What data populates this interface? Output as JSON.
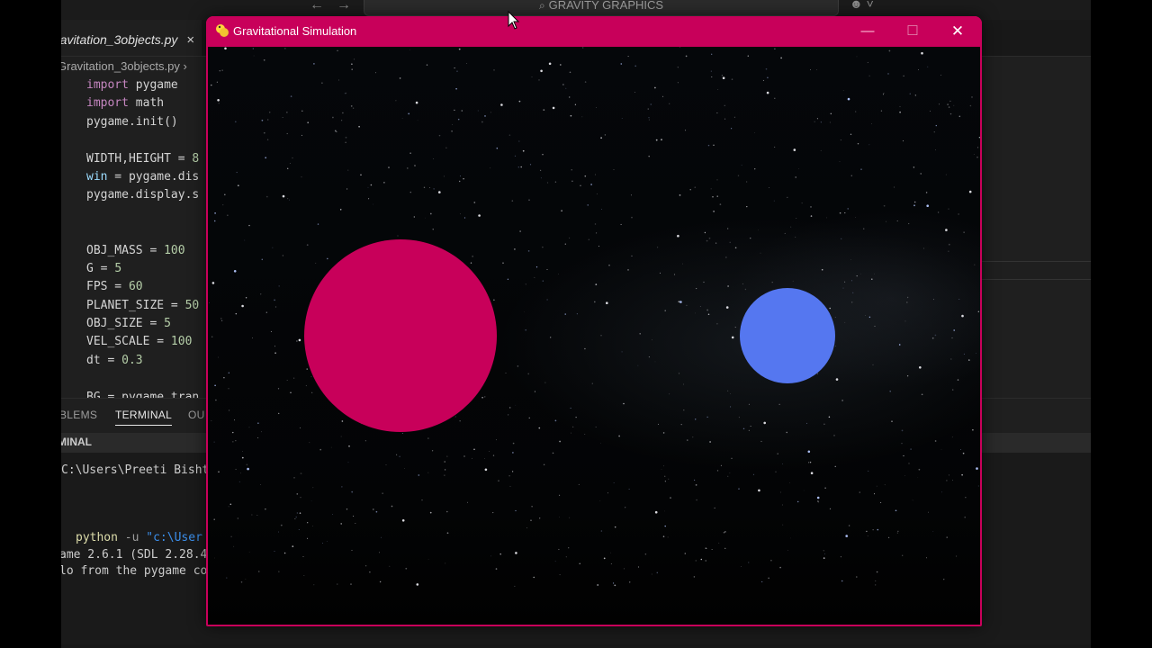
{
  "vscode": {
    "command_center": "GRAVITY GRAPHICS",
    "tab_label": "ravitation_3objects.py",
    "tab_close": "×",
    "breadcrumb_file": "Gravitation_3objects.py",
    "breadcrumb_sep": "›",
    "code": {
      "line1_kw": "import",
      "line1_rest": " pygame",
      "line2_kw": "import",
      "line2_rest": " math",
      "line3": "pygame.init()",
      "line5_name": "WIDTH,HEIGHT = ",
      "line5_val": "8",
      "line6_name": "win",
      "line6_rest": " = pygame.dis",
      "line7": "pygame.display.s",
      "line10_name": "OBJ_MASS = ",
      "line10_val": "100",
      "line11_name": "G = ",
      "line11_val": "5",
      "line12_name": "FPS = ",
      "line12_val": "60",
      "line13_name": "PLANET_SIZE = ",
      "line13_val": "50",
      "line14_name": "OBJ_SIZE = ",
      "line14_val": "5",
      "line15_name": "VEL_SCALE = ",
      "line15_val": "100",
      "line16_name": "dt = ",
      "line16_val": "0.3",
      "line18": "BG = pygame.tran"
    },
    "panel": {
      "tab_problems": "BLEMS",
      "tab_terminal": "TERMINAL",
      "tab_output": "OU",
      "header": "MINAL"
    },
    "terminal": {
      "line1": "C:\\Users\\Preeti Bisht",
      "cmd": "python",
      "flag": " -u ",
      "path": "\"c:\\User",
      "line3": "ame 2.6.1 (SDL 2.28.4",
      "line4": "lo from the pygame co"
    }
  },
  "pygame_window": {
    "title": "Gravitational Simulation",
    "min_glyph": "—",
    "max_glyph": "☐",
    "close_glyph": "✕",
    "planet_color": "#c8005a",
    "object_color": "#5577f0"
  }
}
